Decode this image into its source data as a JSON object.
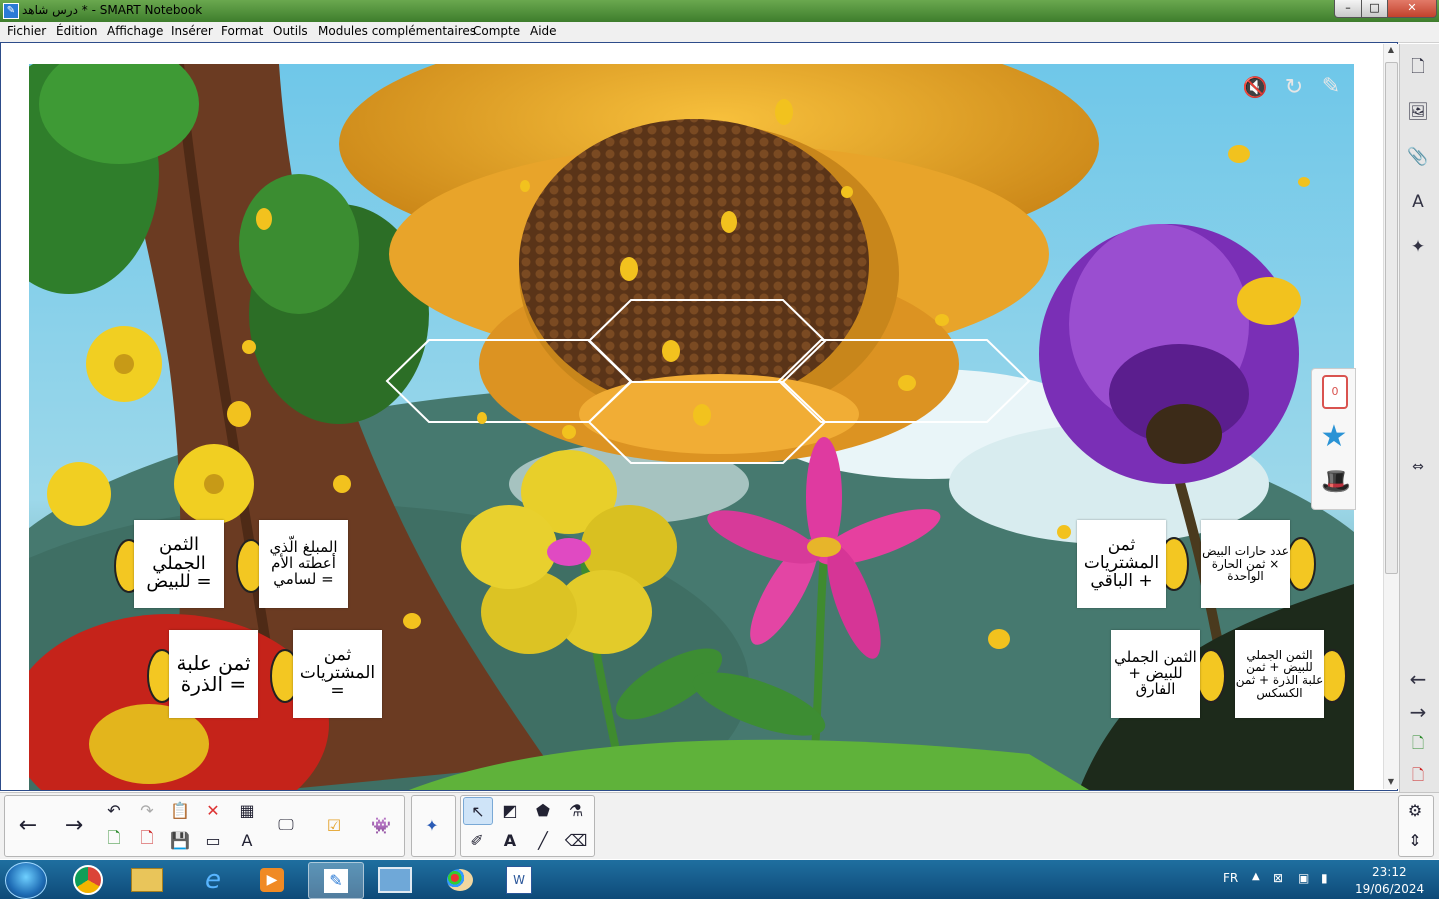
{
  "window": {
    "title": "درس شاهد * - SMART Notebook",
    "minimize": "–",
    "maximize": "□",
    "close": "✕"
  },
  "menu": [
    "Fichier",
    "Édition",
    "Affichage",
    "Insérer",
    "Format",
    "Outils",
    "Modules complémentaires",
    "Compte",
    "Aide"
  ],
  "scene": {
    "cards": [
      {
        "name": "card-total-eggs",
        "text": "الثمن الجملي للبيض ="
      },
      {
        "name": "card-money-given",
        "text": "المبلغ الّذي أعطته الأم لسامي ="
      },
      {
        "name": "card-corn-can",
        "text": "ثمن علبة الذرة ="
      },
      {
        "name": "card-purchases",
        "text": "ثمن المشتريات ="
      },
      {
        "name": "card-purchases-plus-rest",
        "text": "ثمن المشتريات + الباقي"
      },
      {
        "name": "card-egg-trays-times",
        "text": "عدد حارات البيض × ثمن الحارة الواحدة"
      },
      {
        "name": "card-eggs-plus-diff",
        "text": "الثمن الجملي للبيض + الفارق"
      },
      {
        "name": "card-total-sum",
        "text": "الثمن الجملي للبيض + ثمن علبة الذرة + ثمن الكسكس"
      }
    ],
    "top_icons": [
      "mute-icon",
      "refresh-icon",
      "pencil-icon"
    ],
    "widget_counter": "0"
  },
  "sidebar": {
    "icons": [
      "page-sorter-icon",
      "gallery-icon",
      "attachments-icon",
      "properties-icon",
      "addons-icon"
    ],
    "bottom_icons": [
      "prev-page-icon",
      "next-page-icon",
      "add-page-icon",
      "delete-page-icon"
    ],
    "resize_handle": "⇔"
  },
  "toolbar": {
    "icons": [
      "back-icon",
      "forward-icon",
      "undo-icon",
      "redo-icon",
      "paste-icon",
      "delete-icon",
      "table-icon",
      "add-page-icon",
      "delete-page-icon",
      "save-icon",
      "screen-shade-icon",
      "table-insert-icon",
      "display-icon",
      "response-icon",
      "lab-icon",
      "addon-icon",
      "select-icon",
      "shapes-icon",
      "eraser-fill-icon",
      "fill-icon",
      "pens-icon",
      "text-icon",
      "line-icon",
      "eraser-icon",
      "settings-icon",
      "move-toolbar-icon"
    ]
  },
  "taskbar": {
    "lang": "FR",
    "time": "23:12",
    "date": "19/06/2024"
  },
  "colors": {
    "title_gradient_top": "#6aa84f",
    "menu_bg": "#f0f0f0",
    "taskbar": "#0e4a78"
  }
}
